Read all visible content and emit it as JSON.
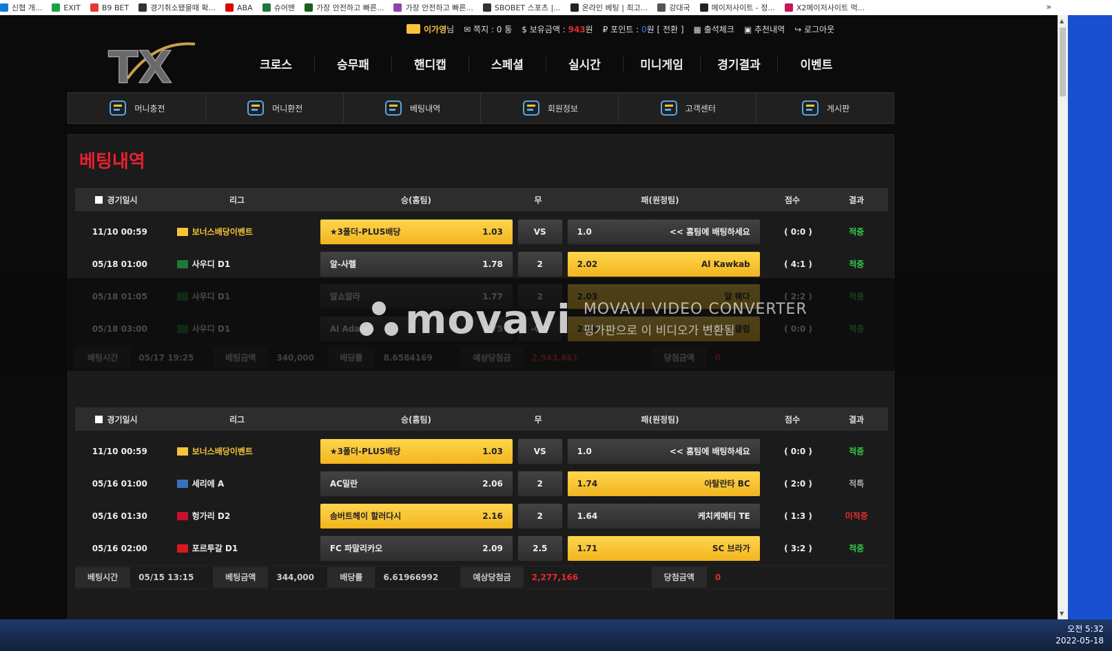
{
  "bookmarks": [
    {
      "label": "신협 개..."
    },
    {
      "label": "EXIT"
    },
    {
      "label": "B9 BET"
    },
    {
      "label": "경기취소됐을때 확..."
    },
    {
      "label": "ABA"
    },
    {
      "label": "슈어맨"
    },
    {
      "label": "가장 안전하고 빠른..."
    },
    {
      "label": "가장 안전하고 빠른..."
    },
    {
      "label": "SBOBET 스포츠 |..."
    },
    {
      "label": "온라인 베팅 | 최고..."
    },
    {
      "label": "강대국"
    },
    {
      "label": "메이저사이트 - 정..."
    },
    {
      "label": "X2메이저사이트 먹..."
    }
  ],
  "bookmarks_more": "»",
  "header": {
    "nickname": "이가영",
    "nickname_suffix": "님",
    "note": "쪽지 : 0 통",
    "balance_label": "$ 보유금액 : ",
    "balance": "943",
    "balance_unit": "원",
    "point_label": "₽ 포인트 : ",
    "point": "0",
    "point_unit": "원 [ 전환 ]",
    "attendance": "출석체크",
    "recommend": "추천내역",
    "logout": "로그아웃",
    "logo_text": "TX"
  },
  "main_nav": [
    "크로스",
    "승무패",
    "핸디캡",
    "스페셜",
    "실시간",
    "미니게임",
    "경기결과",
    "이벤트"
  ],
  "sub_nav": [
    "머니충전",
    "머니환전",
    "베팅내역",
    "회원정보",
    "고객센터",
    "게시판"
  ],
  "page_title": "베팅내역",
  "table_headers": {
    "date": "경기일시",
    "league": "리그",
    "home": "승(홈팀)",
    "draw": "무",
    "away": "패(원정팀)",
    "score": "점수",
    "result": "결과"
  },
  "bets": [
    {
      "rows": [
        {
          "date": "11/10 00:59",
          "league": "보너스배당이벤트",
          "gold": true,
          "home": "★3폴더-PLUS배당",
          "home_odds": "1.03",
          "home_sel": true,
          "draw": "VS",
          "away_odds": "1.0",
          "away": "<< 홈팀에 배팅하세요",
          "away_sel": false,
          "score": "( 0:0 )",
          "result": "적중",
          "result_type": "win"
        },
        {
          "date": "05/18 01:00",
          "league": "사우디 D1",
          "gold": false,
          "home": "알-사헬",
          "home_odds": "1.78",
          "home_sel": false,
          "draw": "2",
          "away_odds": "2.02",
          "away": "Al Kawkab",
          "away_sel": true,
          "score": "( 4:1 )",
          "result": "적중",
          "result_type": "win"
        },
        {
          "date": "05/18 01:05",
          "league": "사우디 D1",
          "gold": false,
          "home": "알쇼알라",
          "home_odds": "1.77",
          "home_sel": false,
          "draw": "2",
          "away_odds": "2.03",
          "away": "알 웨다",
          "away_sel": true,
          "score": "( 2:2 )",
          "result": "적중",
          "result_type": "win"
        },
        {
          "date": "05/18 03:00",
          "league": "사우디 D1",
          "gold": false,
          "home": "Al Adalah",
          "home_odds": "1.75",
          "home_sel": false,
          "draw": "-0.5",
          "away_odds": "2.06",
          "away": "클럽",
          "away_sel": true,
          "score": "( 0:0 )",
          "result": "적중",
          "result_type": "win"
        }
      ],
      "summary": {
        "time_label": "베팅시간",
        "time": "05/17 19:25",
        "amount_label": "베팅금액",
        "amount": "340,000",
        "odds_label": "배당률",
        "odds": "8.6584169",
        "expected_label": "예상당첨금",
        "expected": "2,943,861",
        "win_label": "당첨금액",
        "win": "0"
      }
    },
    {
      "rows": [
        {
          "date": "11/10 00:59",
          "league": "보너스배당이벤트",
          "gold": true,
          "home": "★3폴더-PLUS배당",
          "home_odds": "1.03",
          "home_sel": true,
          "draw": "VS",
          "away_odds": "1.0",
          "away": "<< 홈팀에 배팅하세요",
          "away_sel": false,
          "score": "( 0:0 )",
          "result": "적중",
          "result_type": "win"
        },
        {
          "date": "05/16 01:00",
          "league": "세리에 A",
          "gold": false,
          "home": "AC밀란",
          "home_odds": "2.06",
          "home_sel": false,
          "draw": "2",
          "away_odds": "1.74",
          "away": "아탈란타 BC",
          "away_sel": true,
          "score": "( 2:0 )",
          "result": "적특",
          "result_type": "other"
        },
        {
          "date": "05/16 01:30",
          "league": "헝가리 D2",
          "gold": false,
          "home": "솜버트헤이 할러다시",
          "home_odds": "2.16",
          "home_sel": true,
          "draw": "2",
          "away_odds": "1.64",
          "away": "케치케메티 TE",
          "away_sel": false,
          "score": "( 1:3 )",
          "result": "미적중",
          "result_type": "lose"
        },
        {
          "date": "05/16 02:00",
          "league": "포르투갈 D1",
          "gold": false,
          "home": "FC 파말리카오",
          "home_odds": "2.09",
          "home_sel": false,
          "draw": "2.5",
          "away_odds": "1.71",
          "away": "SC 브라가",
          "away_sel": true,
          "score": "( 3:2 )",
          "result": "적중",
          "result_type": "win"
        }
      ],
      "summary": {
        "time_label": "베팅시간",
        "time": "05/15 13:15",
        "amount_label": "베팅금액",
        "amount": "344,000",
        "odds_label": "배당률",
        "odds": "6.61966992",
        "expected_label": "예상당첨금",
        "expected": "2,277,166",
        "win_label": "당첨금액",
        "win": "0"
      }
    }
  ],
  "watermark": {
    "logo": "movavi",
    "line1": "MOVAVI VIDEO CONVERTER",
    "line2": "평가판으로 이 비디오가 변환됨"
  },
  "clock": {
    "time": "오전 5:32",
    "date": "2022-05-18"
  },
  "colors": {
    "accent_red": "#e8212f",
    "gold": "#f6c33a",
    "win_green": "#2fd14a"
  }
}
